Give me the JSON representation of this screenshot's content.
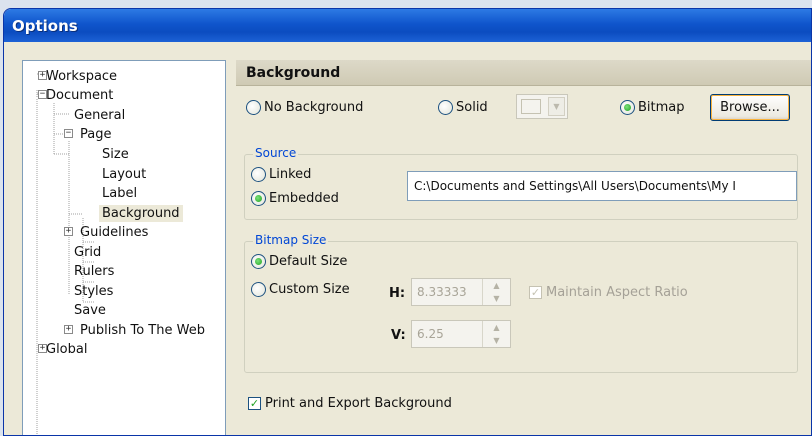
{
  "window": {
    "title": "Options"
  },
  "tree": {
    "items": [
      {
        "label": "Workspace",
        "expander": "+"
      },
      {
        "label": "Document",
        "expander": "−"
      },
      {
        "label": "General"
      },
      {
        "label": "Page",
        "expander": "−"
      },
      {
        "label": "Size"
      },
      {
        "label": "Layout"
      },
      {
        "label": "Label"
      },
      {
        "label": "Background",
        "selected": true
      },
      {
        "label": "Guidelines",
        "expander": "+"
      },
      {
        "label": "Grid"
      },
      {
        "label": "Rulers"
      },
      {
        "label": "Styles"
      },
      {
        "label": "Save"
      },
      {
        "label": "Publish To The Web",
        "expander": "+"
      },
      {
        "label": "Global",
        "expander": "+"
      }
    ]
  },
  "panel": {
    "title": "Background",
    "no_background": "No Background",
    "solid": "Solid",
    "bitmap": "Bitmap",
    "browse": "Browse...",
    "source": {
      "title": "Source",
      "linked": "Linked",
      "embedded": "Embedded",
      "path": "C:\\Documents and Settings\\All Users\\Documents\\My I"
    },
    "bitmap_size": {
      "title": "Bitmap Size",
      "default_size": "Default Size",
      "custom_size": "Custom Size",
      "h_label": "H:",
      "v_label": "V:",
      "h_value": "8.33333",
      "v_value": "6.25",
      "maintain_aspect": "Maintain Aspect Ratio"
    },
    "print_export": "Print and Export Background"
  },
  "colors": {
    "title_bar": "#0f55cc",
    "group_title": "#0046d5",
    "radio_on": "#21a121"
  }
}
